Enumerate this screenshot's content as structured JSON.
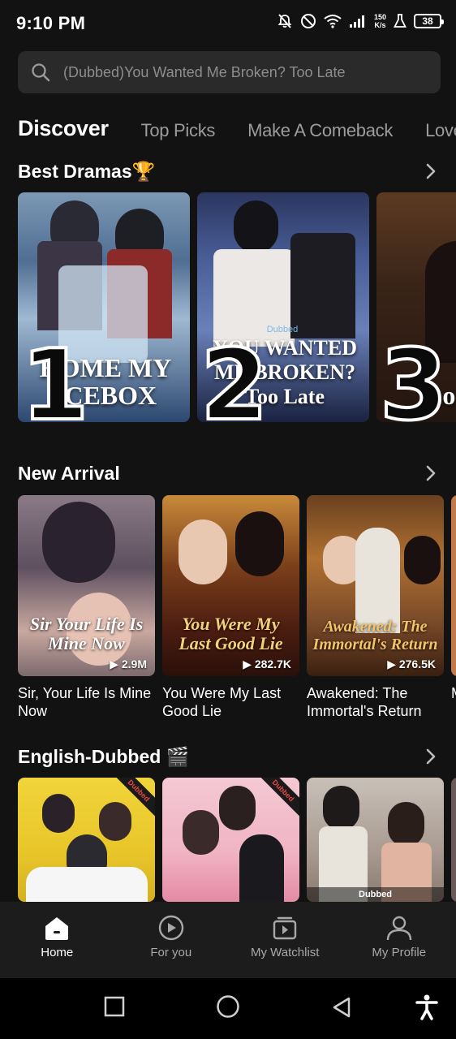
{
  "status_bar": {
    "time": "9:10 PM",
    "net_speed_top": "150",
    "net_speed_bottom": "K/s",
    "battery": "38"
  },
  "search": {
    "placeholder": "(Dubbed)You Wanted Me Broken? Too Late",
    "icon": "search-icon"
  },
  "tabs": [
    {
      "label": "Discover",
      "active": true
    },
    {
      "label": "Top Picks"
    },
    {
      "label": "Make A Comeback"
    },
    {
      "label": "Love"
    }
  ],
  "best_dramas": {
    "title": "Best Dramas",
    "emoji": "🏆",
    "items": [
      {
        "rank": "1",
        "cover_title": "HOME MY ICEBOX"
      },
      {
        "rank": "2",
        "cover_title": "YOU WANTED ME BROKEN? Too Late",
        "badge": "Dubbed"
      },
      {
        "rank": "3",
        "cover_title": "Lo Bitter"
      }
    ]
  },
  "new_arrival": {
    "title": "New Arrival",
    "items": [
      {
        "title": "Sir, Your Life Is Mine Now",
        "cover_title": "Sir Your Life Is Mine Now",
        "views": "2.9M"
      },
      {
        "title": "You Were My Last Good Lie",
        "cover_title": "You Were My Last Good Lie",
        "views": "282.7K"
      },
      {
        "title": "Awakened: The Immortal's Return",
        "cover_title": "Awakened: The Immortal's Return",
        "views": "276.5K"
      },
      {
        "title": "M L"
      }
    ]
  },
  "english_dubbed": {
    "title": "English-Dubbed",
    "emoji": "🎬",
    "items": [
      {
        "badge": "Dubbed"
      },
      {
        "badge": "Dubbed"
      },
      {
        "badge": "Dubbed"
      }
    ]
  },
  "bottom_nav": [
    {
      "label": "Home",
      "icon": "home-icon",
      "active": true
    },
    {
      "label": "For you",
      "icon": "play-circle-icon"
    },
    {
      "label": "My Watchlist",
      "icon": "watchlist-icon"
    },
    {
      "label": "My Profile",
      "icon": "profile-icon"
    }
  ],
  "colors": {
    "background": "#121212",
    "search_bg": "#2a2a2a",
    "nav_bg": "#1c1c1c",
    "inactive_text": "#9c9c9c"
  }
}
